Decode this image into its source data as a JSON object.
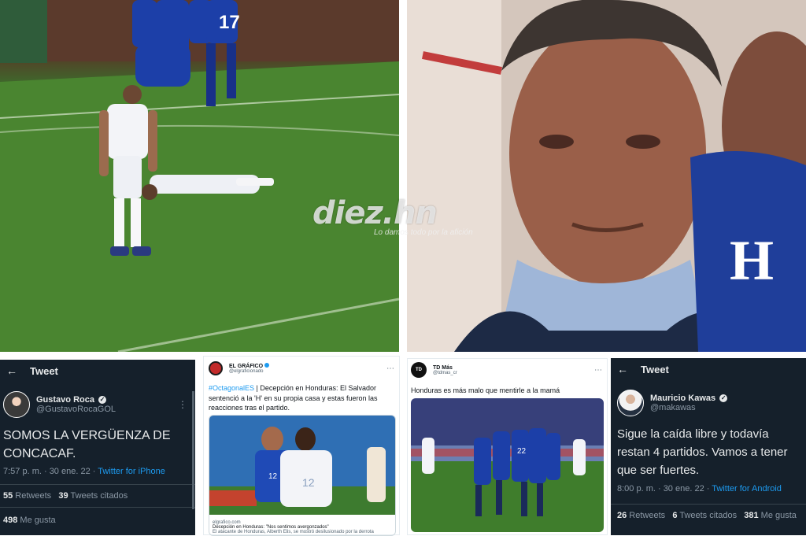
{
  "watermark": {
    "logo": "diez.hn",
    "tagline": "Lo damos todo por la afición"
  },
  "tweet1": {
    "header": "Tweet",
    "name": "Gustavo Roca",
    "handle": "@GustavoRocaGOL",
    "text": "SOMOS LA VERGÜENZA DE CONCACAF.",
    "time": "7:57 p. m. · 30 ene. 22 · ",
    "source": "Twitter for iPhone",
    "retweets_count": "55",
    "retweets_label": " Retweets",
    "quotes_count": "39",
    "quotes_label": " Tweets citados",
    "likes_count": "498",
    "likes_label": " Me gusta"
  },
  "tweet2": {
    "name": "EL GRÁFICO",
    "handle": "@elgraficionado",
    "hashtag": "#OctagonalES",
    "text": " | Decepción en Honduras: El Salvador sentenció a la 'H' en su propia casa y estas fueron las reacciones tras el partido.",
    "link_domain": "elgrafico.com",
    "link_title": "Decepción en Honduras: \"Nos sentimos avergonzados\"",
    "link_desc": "El atacante de Honduras, Alberth Elis, se mostró desilusionado por la derrota"
  },
  "tweet3": {
    "name": "TD Más",
    "handle": "@tdmas_cr",
    "text": "Honduras es más malo que mentirle a la mamá"
  },
  "tweet4": {
    "header": "Tweet",
    "name": "Mauricio Kawas",
    "handle": "@makawas",
    "text": "Sigue la caída libre y todavía restan 4 partidos. Vamos a tener que ser fuertes.",
    "time": "8:00 p. m. · 30 ene. 22 · ",
    "source": "Twitter for Android",
    "retweets_count": "26",
    "retweets_label": " Retweets",
    "quotes_count": "6",
    "quotes_label": " Tweets citados",
    "likes_count": "381",
    "likes_label": " Me gusta"
  },
  "colors": {
    "dark_bg": "#15202b",
    "link_blue": "#1d9bf0",
    "salvador_blue": "#1c3fa8",
    "pitch_green": "#4f8a33"
  },
  "icons": [
    "back-arrow-icon",
    "verified-badge-icon",
    "more-icon",
    "honduras-h-crest-icon"
  ]
}
